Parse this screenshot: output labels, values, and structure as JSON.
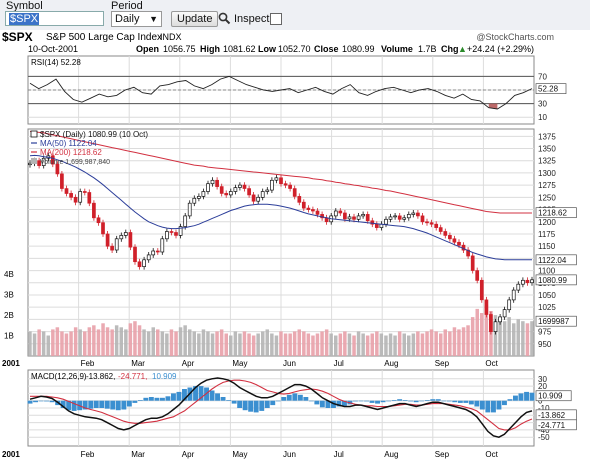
{
  "toolbar": {
    "symbol_label": "Symbol",
    "symbol_value": "$SPX",
    "period_label": "Period",
    "period_value": "Daily",
    "update_label": "Update",
    "inspect_label": "Inspect",
    "inspect_checked": false
  },
  "header": {
    "symbol": "$SPX",
    "name": "S&P 500 Large Cap Index",
    "exchange": "INDX",
    "watermark": "@StockCharts.com",
    "date": "10-Oct-2001",
    "open_label": "Open",
    "open": "1056.75",
    "high_label": "High",
    "high": "1081.62",
    "low_label": "Low",
    "low": "1052.70",
    "close_label": "Close",
    "close": "1080.99",
    "volume_label": "Volume",
    "volume": "1.7B",
    "chg_label": "Chg",
    "chg": "+24.24 (+2.29%)",
    "chg_arrow": "▲"
  },
  "colors": {
    "up": "#111111",
    "down": "#d0202a",
    "ma50": "#2c3e9a",
    "ma200": "#d23040",
    "rsi_fill": "#b05050",
    "macd_hist": "#3b8fd0",
    "volume_up": "#b4b4b4",
    "volume_down": "#e8a0a8",
    "grid": "#dcdcdc",
    "panel_border": "#888888"
  },
  "chart_data": [
    {
      "type": "line",
      "title": "RSI(14) 52.28",
      "legend": "RSI(14) 52.28",
      "ylim": [
        0,
        100
      ],
      "yticks": [
        "70",
        "50",
        "30",
        "10"
      ],
      "reference_lines": [
        70,
        30
      ],
      "last_value": "52.28",
      "series": [
        {
          "name": "RSI(14)",
          "values": [
            60,
            52,
            58,
            66,
            48,
            36,
            32,
            38,
            44,
            40,
            42,
            50,
            54,
            46,
            44,
            56,
            58,
            62,
            64,
            56,
            52,
            58,
            66,
            70,
            64,
            58,
            54,
            50,
            48,
            50,
            52,
            46,
            50,
            54,
            48,
            44,
            52,
            58,
            46,
            42,
            48,
            52,
            54,
            50,
            46,
            50,
            52,
            48,
            42,
            38,
            44,
            36,
            34,
            24,
            22,
            30,
            42,
            46,
            52
          ]
        }
      ]
    },
    {
      "type": "candlestick",
      "title": "$SPX (Daily) 1080.99 (10 Oct)",
      "legend": [
        "$SPX (Daily) 1080.99 (10 Oct)",
        "MA(50) 1122.04",
        "MA(200) 1218.62",
        "Volume 1,699,987,840"
      ],
      "ylim": [
        925,
        1390
      ],
      "yticks": [
        "1375",
        "1350",
        "1325",
        "1300",
        "1275",
        "1250",
        "1225",
        "1200",
        "1175",
        "1150",
        "1125",
        "1100",
        "1075",
        "1050",
        "1025",
        "1000",
        "975",
        "950"
      ],
      "last_labels": {
        "ma200": "1218.62",
        "ma50": "1122.04",
        "close": "1080.99",
        "volume": "1699987"
      },
      "volume_ticks": [
        "4B",
        "3B",
        "2B",
        "1B"
      ],
      "close": [
        1320,
        1325,
        1315,
        1330,
        1335,
        1318,
        1298,
        1268,
        1258,
        1250,
        1240,
        1262,
        1260,
        1238,
        1208,
        1198,
        1175,
        1150,
        1142,
        1165,
        1172,
        1178,
        1148,
        1118,
        1108,
        1122,
        1132,
        1140,
        1138,
        1165,
        1180,
        1178,
        1172,
        1190,
        1212,
        1238,
        1248,
        1252,
        1262,
        1278,
        1285,
        1272,
        1258,
        1255,
        1262,
        1270,
        1275,
        1268,
        1255,
        1242,
        1250,
        1262,
        1265,
        1285,
        1290,
        1278,
        1275,
        1268,
        1252,
        1240,
        1228,
        1225,
        1222,
        1215,
        1208,
        1200,
        1212,
        1222,
        1218,
        1206,
        1210,
        1205,
        1212,
        1215,
        1202,
        1195,
        1188,
        1195,
        1205,
        1210,
        1212,
        1205,
        1208,
        1215,
        1218,
        1212,
        1200,
        1198,
        1195,
        1188,
        1180,
        1172,
        1165,
        1158,
        1152,
        1142,
        1130,
        1100,
        1080,
        1040,
        1010,
        975,
        995,
        1005,
        1020,
        1040,
        1060,
        1072,
        1080,
        1075,
        1081
      ],
      "ma50": [
        1335,
        1336,
        1335,
        1333,
        1332,
        1330,
        1327,
        1324,
        1320,
        1316,
        1312,
        1307,
        1302,
        1296,
        1290,
        1283,
        1276,
        1268,
        1260,
        1252,
        1244,
        1236,
        1228,
        1220,
        1213,
        1206,
        1200,
        1196,
        1192,
        1189,
        1187,
        1186,
        1186,
        1187,
        1188,
        1190,
        1192,
        1195,
        1199,
        1203,
        1207,
        1211,
        1215,
        1219,
        1223,
        1226,
        1229,
        1232,
        1234,
        1235,
        1236,
        1236,
        1236,
        1235,
        1234,
        1232,
        1230,
        1228,
        1225,
        1222,
        1219,
        1216,
        1214,
        1212,
        1210,
        1208,
        1206,
        1205,
        1204,
        1203,
        1202,
        1201,
        1200,
        1199,
        1198,
        1197,
        1196,
        1195,
        1194,
        1193,
        1192,
        1191,
        1190,
        1188,
        1186,
        1183,
        1180,
        1177,
        1173,
        1169,
        1165,
        1161,
        1157,
        1153,
        1149,
        1145,
        1141,
        1137,
        1134,
        1131,
        1128,
        1126,
        1124,
        1123,
        1122,
        1122,
        1122,
        1122,
        1122,
        1122,
        1122
      ],
      "ma200": [
        1385,
        1384,
        1383,
        1382,
        1380,
        1378,
        1376,
        1374,
        1372,
        1370,
        1368,
        1366,
        1364,
        1362,
        1360,
        1358,
        1356,
        1354,
        1352,
        1350,
        1348,
        1346,
        1344,
        1342,
        1340,
        1338,
        1336,
        1334,
        1332,
        1330,
        1328,
        1326,
        1324,
        1322,
        1320,
        1318,
        1316,
        1315,
        1314,
        1312,
        1311,
        1310,
        1309,
        1308,
        1307,
        1306,
        1305,
        1304,
        1303,
        1302,
        1301,
        1300,
        1299,
        1298,
        1297,
        1296,
        1295,
        1294,
        1293,
        1292,
        1291,
        1290,
        1288,
        1287,
        1286,
        1284,
        1283,
        1281,
        1280,
        1278,
        1277,
        1275,
        1274,
        1272,
        1271,
        1269,
        1268,
        1266,
        1264,
        1263,
        1261,
        1259,
        1257,
        1255,
        1253,
        1251,
        1249,
        1247,
        1245,
        1243,
        1241,
        1239,
        1237,
        1235,
        1233,
        1231,
        1229,
        1227,
        1225,
        1223,
        1221,
        1220,
        1219,
        1218,
        1218,
        1218,
        1218,
        1218,
        1218,
        1218,
        1218
      ],
      "volume_billions": [
        1.2,
        1.1,
        1.3,
        1.2,
        1.0,
        1.3,
        1.4,
        1.2,
        1.1,
        1.2,
        1.4,
        1.3,
        1.2,
        1.4,
        1.5,
        1.3,
        1.6,
        1.4,
        1.3,
        1.5,
        1.4,
        1.3,
        1.6,
        1.7,
        1.5,
        1.3,
        1.2,
        1.4,
        1.3,
        1.2,
        1.1,
        1.3,
        1.2,
        1.4,
        1.5,
        1.3,
        1.2,
        1.1,
        1.3,
        1.2,
        1.1,
        1.2,
        1.3,
        1.1,
        1.0,
        1.2,
        1.1,
        1.2,
        1.1,
        1.0,
        1.1,
        1.2,
        1.3,
        1.1,
        1.0,
        1.2,
        1.1,
        1.1,
        1.2,
        1.3,
        1.2,
        1.1,
        1.0,
        1.1,
        1.2,
        1.3,
        1.1,
        1.0,
        1.1,
        1.2,
        1.1,
        1.0,
        1.2,
        1.1,
        1.0,
        1.1,
        1.2,
        1.1,
        1.0,
        1.1,
        1.0,
        1.2,
        1.1,
        1.0,
        1.1,
        1.2,
        1.1,
        1.2,
        1.3,
        1.2,
        1.1,
        1.3,
        1.2,
        1.4,
        1.3,
        1.4,
        1.5,
        1.9,
        2.3,
        2.1,
        2.5,
        2.2,
        2.0,
        1.8,
        1.7,
        1.9,
        1.6,
        1.8,
        1.7,
        1.6,
        1.7
      ]
    },
    {
      "type": "line",
      "title": "MACD(12,26,9) -13.862, -24.771, 10.909",
      "legend": {
        "label": "MACD(12,26,9)",
        "macd": "-13.862",
        "signal": "-24.771",
        "hist": "10.909"
      },
      "ylim": [
        -62,
        42
      ],
      "yticks": [
        "30",
        "20",
        "10",
        "0",
        "-10",
        "-20",
        "-30",
        "-40",
        "-50"
      ],
      "last_labels": {
        "hist": "10.909",
        "macd": "-13.862",
        "signal": "-24.771"
      },
      "series": [
        {
          "name": "MACD",
          "values": [
            2,
            4,
            6,
            5,
            3,
            -2,
            -8,
            -14,
            -18,
            -20,
            -22,
            -23,
            -24,
            -26,
            -30,
            -34,
            -38,
            -40,
            -38,
            -34,
            -30,
            -26,
            -24,
            -24,
            -22,
            -18,
            -12,
            -6,
            2,
            10,
            18,
            24,
            28,
            30,
            31,
            30,
            28,
            24,
            18,
            14,
            10,
            6,
            4,
            4,
            6,
            10,
            14,
            18,
            22,
            22,
            20,
            16,
            10,
            4,
            0,
            -4,
            -6,
            -8,
            -8,
            -6,
            -6,
            -8,
            -10,
            -12,
            -10,
            -8,
            -6,
            -4,
            -4,
            -6,
            -8,
            -6,
            -4,
            -2,
            -2,
            -4,
            -6,
            -8,
            -10,
            -12,
            -16,
            -22,
            -32,
            -42,
            -48,
            -50,
            -46,
            -38,
            -30,
            -22,
            -16,
            -14
          ]
        },
        {
          "name": "Signal",
          "values": [
            6,
            6,
            6,
            6,
            5,
            4,
            2,
            -1,
            -4,
            -7,
            -10,
            -12,
            -14,
            -16,
            -19,
            -22,
            -25,
            -28,
            -30,
            -31,
            -31,
            -30,
            -29,
            -28,
            -26,
            -24,
            -22,
            -18,
            -14,
            -8,
            -2,
            4,
            10,
            16,
            21,
            25,
            27,
            28,
            28,
            27,
            25,
            22,
            18,
            14,
            12,
            10,
            9,
            10,
            12,
            14,
            15,
            16,
            15,
            13,
            10,
            6,
            2,
            -1,
            -3,
            -5,
            -6,
            -7,
            -7,
            -8,
            -8,
            -8,
            -7,
            -6,
            -5,
            -5,
            -6,
            -6,
            -5,
            -4,
            -4,
            -4,
            -5,
            -6,
            -7,
            -9,
            -11,
            -14,
            -20,
            -26,
            -32,
            -38,
            -40,
            -40,
            -37,
            -32,
            -28,
            -25
          ]
        }
      ]
    }
  ],
  "x_axis": {
    "labels": [
      "2001",
      "Feb",
      "Mar",
      "Apr",
      "May",
      "Jun",
      "Jul",
      "Aug",
      "Sep",
      "Oct"
    ]
  }
}
